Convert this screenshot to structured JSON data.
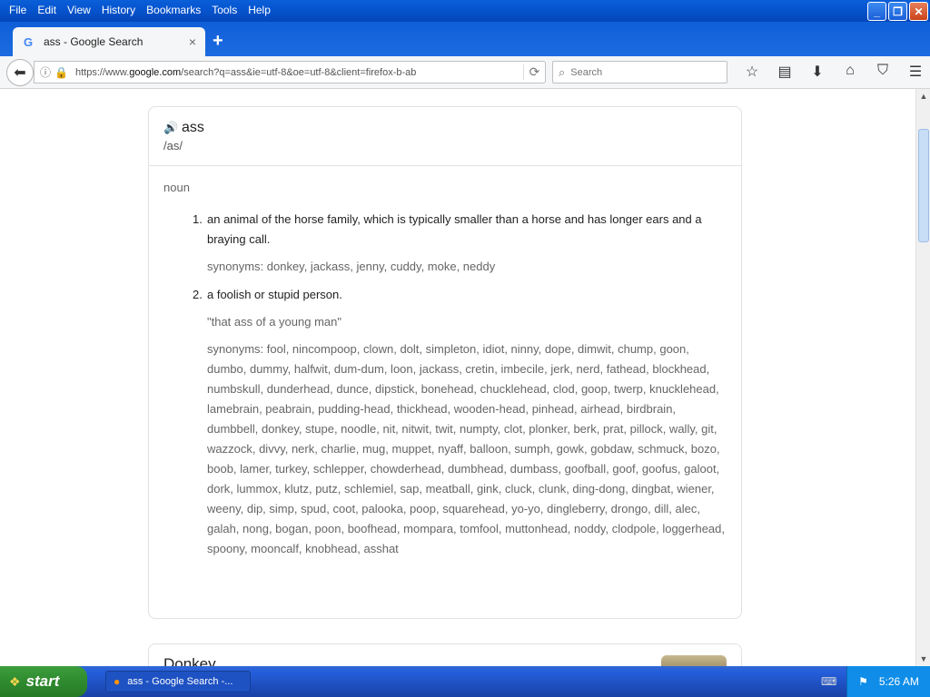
{
  "menu": [
    "File",
    "Edit",
    "View",
    "History",
    "Bookmarks",
    "Tools",
    "Help"
  ],
  "window_controls": [
    "minimize-icon",
    "restore-icon",
    "close-icon"
  ],
  "tab": {
    "title": "ass - Google Search",
    "favicon": "G",
    "close": "×"
  },
  "newtab": "+",
  "urlbar": {
    "prefix": "https://www.",
    "domain": "google.com",
    "suffix": "/search?q=ass&ie=utf-8&oe=utf-8&client=firefox-b-ab"
  },
  "search": {
    "placeholder": "Search"
  },
  "toolbar_icons": [
    "star-icon",
    "reader-icon",
    "download-icon",
    "home-icon",
    "pocket-icon",
    "menu-icon"
  ],
  "dictionary": {
    "word": "ass",
    "pronunciation": "/as/",
    "part_of_speech": "noun",
    "senses": [
      {
        "number": "1.",
        "definition": "an animal of the horse family, which is typically smaller than a horse and has longer ears and a braying call.",
        "synonyms_label": "synonyms: ",
        "synonyms": "donkey, jackass, jenny, cuddy, moke, neddy"
      },
      {
        "number": "2.",
        "definition": "a foolish or stupid person.",
        "example": "\"that ass of a young man\"",
        "synonyms_label": "synonyms: ",
        "synonyms": "fool, nincompoop, clown, dolt, simpleton, idiot, ninny, dope, dimwit, chump, goon, dumbo, dummy, halfwit, dum-dum, loon, jackass, cretin, imbecile, jerk, nerd, fathead, blockhead, numbskull, dunderhead, dunce, dipstick, bonehead, chucklehead, clod, goop, twerp, knucklehead, lamebrain, peabrain, pudding-head, thickhead, wooden-head, pinhead, airhead, birdbrain, dumbbell, donkey, stupe, noodle, nit, nitwit, twit, numpty, clot, plonker, berk, prat, pillock, wally, git, wazzock, divvy, nerk, charlie, mug, muppet, nyaff, balloon, sumph, gowk, gobdaw, schmuck, bozo, boob, lamer, turkey, schlepper, chowderhead, dumbhead, dumbass, goofball, goof, goofus, galoot, dork, lummox, klutz, putz, schlemiel, sap, meatball, gink, cluck, clunk, ding-dong, dingbat, wiener, weeny, dip, simp, spud, coot, palooka, poop, squarehead, yo-yo, dingleberry, drongo, dill, alec, galah, nong, bogan, poon, boofhead, mompara, tomfool, muttonhead, noddy, clodpole, loggerhead, spoony, mooncalf, knobhead, asshat"
      }
    ]
  },
  "next_result": {
    "title": "Donkey"
  },
  "taskbar": {
    "start_label": "start",
    "task_label": "ass - Google Search -...",
    "clock": "5:26 AM"
  }
}
